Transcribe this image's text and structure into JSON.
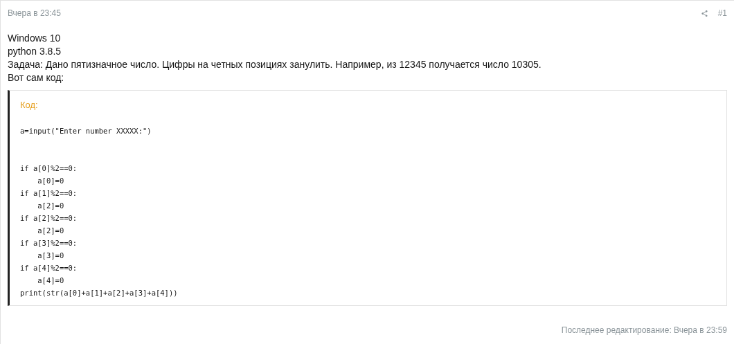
{
  "post": {
    "date": "Вчера в 23:45",
    "number": "#1",
    "body": [
      "Windows 10",
      "python 3.8.5",
      "Задача: Дано пятизначное число. Цифры на четных позициях занулить. Например, из 12345 получается число 10305.",
      "Вот сам код:"
    ],
    "code_block": {
      "label": "Код:",
      "code": "a=input(\"Enter number XXXXX:\")\n\n\nif a[0]%2==0:\n    a[0]=0\nif a[1]%2==0:\n    a[2]=0\nif a[2]%2==0:\n    a[2]=0\nif a[3]%2==0:\n    a[3]=0\nif a[4]%2==0:\n    a[4]=0\nprint(str(a[0]+a[1]+a[2]+a[3]+a[4]))"
    },
    "last_edited": "Последнее редактирование: Вчера в 23:59"
  }
}
